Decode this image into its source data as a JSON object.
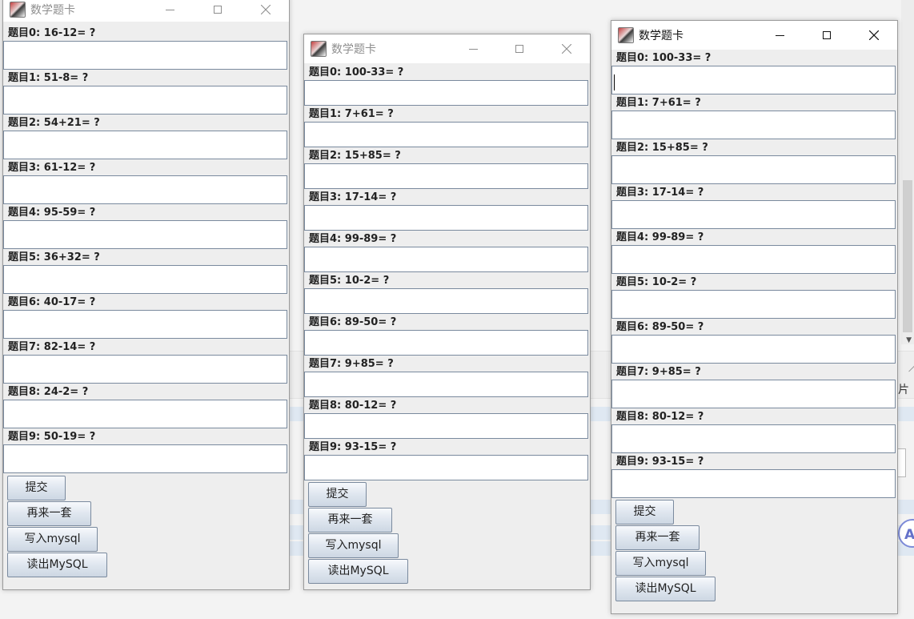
{
  "windows": [
    {
      "title": "数学题卡",
      "questions": [
        {
          "label": "题目0: 16-12= ?",
          "value": ""
        },
        {
          "label": "题目1: 51-8= ?",
          "value": ""
        },
        {
          "label": "题目2: 54+21= ?",
          "value": ""
        },
        {
          "label": "题目3: 61-12= ?",
          "value": ""
        },
        {
          "label": "题目4: 95-59= ?",
          "value": ""
        },
        {
          "label": "题目5: 36+32= ?",
          "value": ""
        },
        {
          "label": "题目6: 40-17= ?",
          "value": ""
        },
        {
          "label": "题目7: 82-14= ?",
          "value": ""
        },
        {
          "label": "题目8: 24-2= ?",
          "value": ""
        },
        {
          "label": "题目9: 50-19= ?",
          "value": ""
        }
      ],
      "buttons": {
        "submit": "提交",
        "again": "再来一套",
        "write": "写入mysql",
        "read": "读出MySQL"
      }
    },
    {
      "title": "数学题卡",
      "questions": [
        {
          "label": "题目0: 100-33= ?",
          "value": ""
        },
        {
          "label": "题目1: 7+61= ?",
          "value": ""
        },
        {
          "label": "题目2: 15+85= ?",
          "value": ""
        },
        {
          "label": "题目3: 17-14= ?",
          "value": ""
        },
        {
          "label": "题目4: 99-89= ?",
          "value": ""
        },
        {
          "label": "题目5: 10-2= ?",
          "value": ""
        },
        {
          "label": "题目6: 89-50= ?",
          "value": ""
        },
        {
          "label": "题目7: 9+85= ?",
          "value": ""
        },
        {
          "label": "题目8: 80-12= ?",
          "value": ""
        },
        {
          "label": "题目9: 93-15= ?",
          "value": ""
        }
      ],
      "buttons": {
        "submit": "提交",
        "again": "再来一套",
        "write": "写入mysql",
        "read": "读出MySQL"
      }
    },
    {
      "title": "数学题卡",
      "questions": [
        {
          "label": "题目0: 100-33= ?",
          "value": ""
        },
        {
          "label": "题目1: 7+61= ?",
          "value": ""
        },
        {
          "label": "题目2: 15+85= ?",
          "value": ""
        },
        {
          "label": "题目3: 17-14= ?",
          "value": ""
        },
        {
          "label": "题目4: 99-89= ?",
          "value": ""
        },
        {
          "label": "题目5: 10-2= ?",
          "value": ""
        },
        {
          "label": "题目6: 89-50= ?",
          "value": ""
        },
        {
          "label": "题目7: 9+85= ?",
          "value": ""
        },
        {
          "label": "题目8: 80-12= ?",
          "value": ""
        },
        {
          "label": "题目9: 93-15= ?",
          "value": ""
        }
      ],
      "buttons": {
        "submit": "提交",
        "again": "再来一套",
        "write": "写入mysql",
        "read": "读出MySQL"
      }
    }
  ],
  "background": {
    "partial_text": "片",
    "ai_badge": "Ai"
  }
}
